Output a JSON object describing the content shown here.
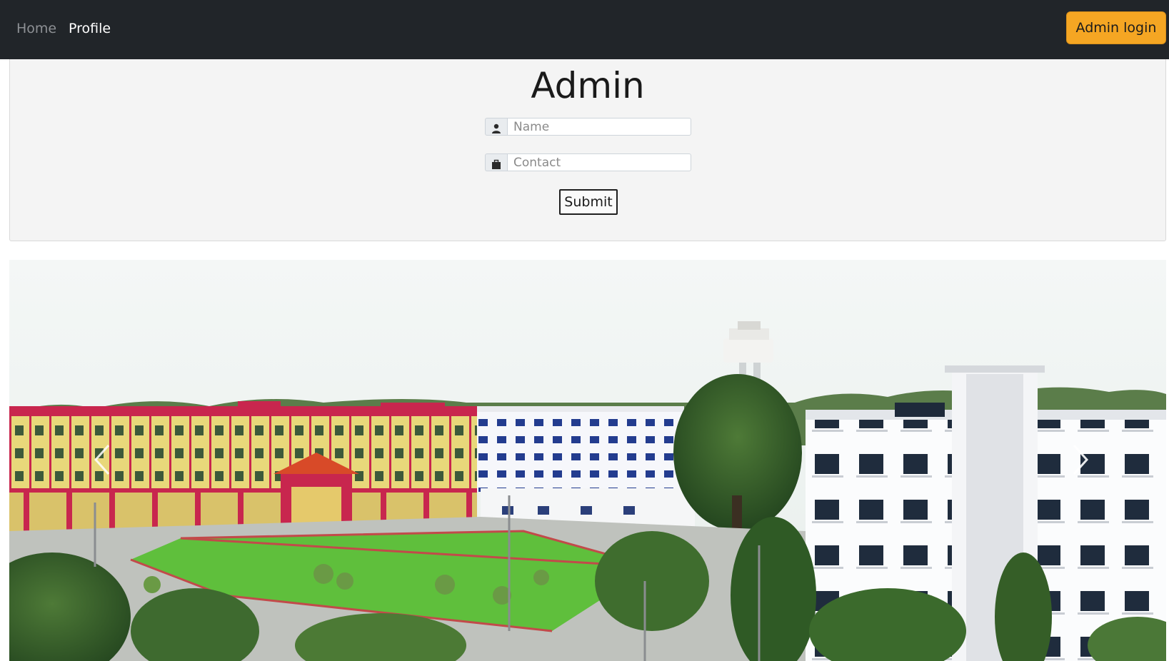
{
  "navbar": {
    "links": [
      {
        "label": "Home"
      },
      {
        "label": "Profile"
      }
    ],
    "admin_login_label": "Admin login"
  },
  "form": {
    "title": "Admin",
    "name_placeholder": "Name",
    "contact_placeholder": "Contact",
    "submit_label": "Submit"
  },
  "carousel": {
    "prev_icon": "chevron-left-icon",
    "next_icon": "chevron-right-icon",
    "image": "campus-buildings-photo"
  },
  "colors": {
    "navbar_bg": "#212529",
    "admin_button": "#f5a623",
    "jumbotron_bg": "#f4f4f4"
  }
}
